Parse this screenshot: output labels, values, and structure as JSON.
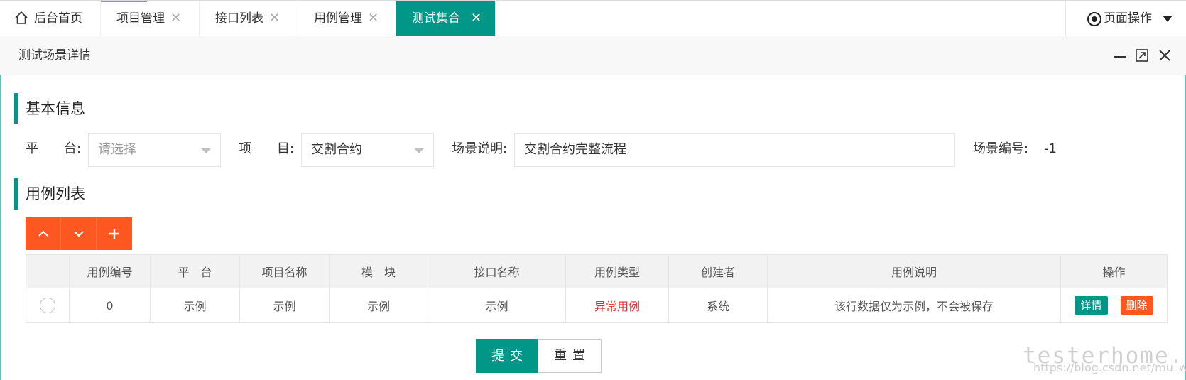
{
  "tabs": [
    {
      "label": "后台首页",
      "closable": false,
      "active": false
    },
    {
      "label": "项目管理",
      "closable": true,
      "active": false
    },
    {
      "label": "接口列表",
      "closable": true,
      "active": false
    },
    {
      "label": "用例管理",
      "closable": true,
      "active": false
    },
    {
      "label": "测试集合",
      "closable": true,
      "active": true
    }
  ],
  "close_glyph": "✕",
  "page_ops": {
    "label": "页面操作"
  },
  "window": {
    "title": "测试场景详情"
  },
  "basic": {
    "heading": "基本信息",
    "platform_label": "平　　台:",
    "platform_placeholder": "请选择",
    "project_label": "项　　目:",
    "project_value": "交割合约",
    "desc_label": "场景说明:",
    "desc_value": "交割合约完整流程",
    "id_label": "场景编号:",
    "id_value": "-1"
  },
  "cases": {
    "heading": "用例列表",
    "buttons": [
      "chevron-up-icon",
      "chevron-down-icon",
      "plus-icon"
    ],
    "columns": [
      "",
      "用例编号",
      "平　台",
      "项目名称",
      "模　块",
      "接口名称",
      "用例类型",
      "创建者",
      "用例说明",
      "操作"
    ],
    "rows": [
      {
        "id": "0",
        "platform": "示例",
        "project": "示例",
        "module": "示例",
        "api": "示例",
        "type": "异常用例",
        "creator": "系统",
        "desc": "该行数据仅为示例，不会被保存",
        "detail_label": "详情",
        "delete_label": "删除"
      }
    ]
  },
  "footer": {
    "submit_label": "提交",
    "reset_label": "重置"
  },
  "watermark": {
    "text": "testerhome.com",
    "url": "https://blog.csdn.net/mu_wind"
  },
  "colors": {
    "accent": "#009688",
    "orange": "#FF5722",
    "red_text": "#e62e2e"
  }
}
